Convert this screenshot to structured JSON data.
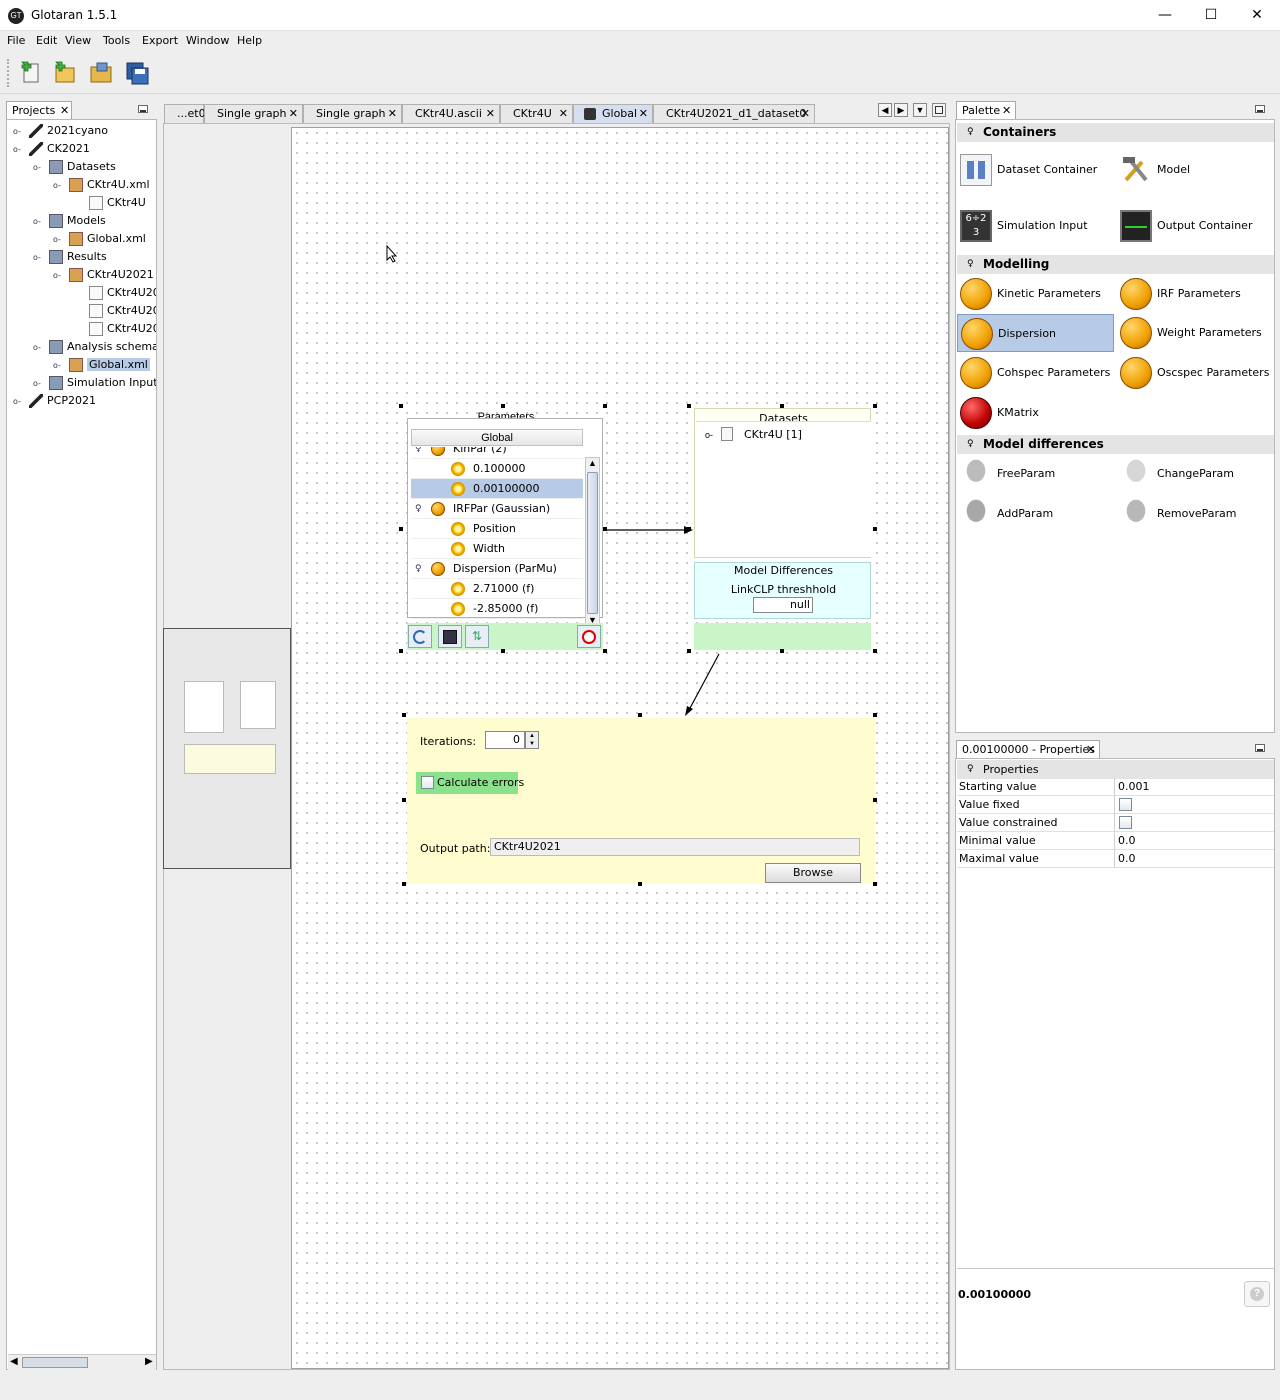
{
  "window": {
    "title": "Glotaran 1.5.1",
    "minimize": "—",
    "maximize": "☐",
    "close": "✕"
  },
  "menu": [
    "File",
    "Edit",
    "View",
    "Tools",
    "Export",
    "Window",
    "Help"
  ],
  "projects_panel": {
    "tab": "Projects",
    "tree": [
      {
        "label": "2021cyano",
        "indent": 0
      },
      {
        "label": "CK2021",
        "indent": 0
      },
      {
        "label": "Datasets",
        "indent": 1
      },
      {
        "label": "CKtr4U.xml",
        "indent": 2
      },
      {
        "label": "CKtr4U",
        "indent": 3
      },
      {
        "label": "Models",
        "indent": 1
      },
      {
        "label": "Global.xml",
        "indent": 2
      },
      {
        "label": "Results",
        "indent": 1
      },
      {
        "label": "CKtr4U2021",
        "indent": 2
      },
      {
        "label": "CKtr4U20",
        "indent": 3
      },
      {
        "label": "CKtr4U20",
        "indent": 3
      },
      {
        "label": "CKtr4U20",
        "indent": 3
      },
      {
        "label": "Analysis schema",
        "indent": 1
      },
      {
        "label": "Global.xml",
        "indent": 2
      },
      {
        "label": "Simulation Input",
        "indent": 1
      },
      {
        "label": "PCP2021",
        "indent": 0
      }
    ]
  },
  "editor_tabs": [
    {
      "label": "...et0"
    },
    {
      "label": "Single graph"
    },
    {
      "label": "Single graph"
    },
    {
      "label": "CKtr4U.ascii"
    },
    {
      "label": "CKtr4U"
    },
    {
      "label": "Global"
    },
    {
      "label": "CKtr4U2021_d1_dataset0"
    }
  ],
  "parameters_node": {
    "title": "Parameters",
    "column": "Global",
    "rows": [
      {
        "label": "KinPar (2)"
      },
      {
        "label": "0.100000"
      },
      {
        "label": "0.00100000"
      },
      {
        "label": "IRFPar (Gaussian)"
      },
      {
        "label": "Position"
      },
      {
        "label": "Width"
      },
      {
        "label": "Dispersion (ParMu)"
      },
      {
        "label": "2.71000 (f)"
      },
      {
        "label": "-2.85000 (f)"
      }
    ]
  },
  "datasets_node": {
    "title": "Datasets",
    "item": "CKtr4U [1]",
    "model_diff_title": "Model Differences",
    "threshold_label": "LinkCLP threshhold",
    "threshold_value": "null"
  },
  "output_node": {
    "iterations_label": "Iterations:",
    "iterations_value": "0",
    "calc_errors_label": "Calculate errors",
    "output_path_label": "Output path:",
    "output_path_value": "CKtr4U2021",
    "browse_label": "Browse"
  },
  "palette": {
    "tab": "Palette",
    "sections": [
      {
        "title": "Containers",
        "items": [
          "Dataset Container",
          "Model",
          "Simulation Input",
          "Output Container"
        ]
      },
      {
        "title": "Modelling",
        "items": [
          "Kinetic Parameters",
          "IRF Parameters",
          "Dispersion",
          "Weight Parameters",
          "Cohspec Parameters",
          "Oscspec Parameters",
          "KMatrix"
        ]
      },
      {
        "title": "Model differences",
        "items": [
          "FreeParam",
          "ChangeParam",
          "AddParam",
          "RemoveParam"
        ]
      }
    ]
  },
  "properties": {
    "tab": "0.00100000 - Properties",
    "section": "Properties",
    "rows": [
      {
        "name": "Starting value",
        "value": "0.001"
      },
      {
        "name": "Value fixed",
        "value": ""
      },
      {
        "name": "Value constrained",
        "value": ""
      },
      {
        "name": "Minimal value",
        "value": "0.0"
      },
      {
        "name": "Maximal value",
        "value": "0.0"
      }
    ],
    "description_title": "0.00100000",
    "help": "?"
  },
  "colors": {
    "accent": "#b8cbe6",
    "node_green": "#c9f5c9",
    "node_yellow": "#fffdd0",
    "node_cyan": "#e6ffff"
  }
}
